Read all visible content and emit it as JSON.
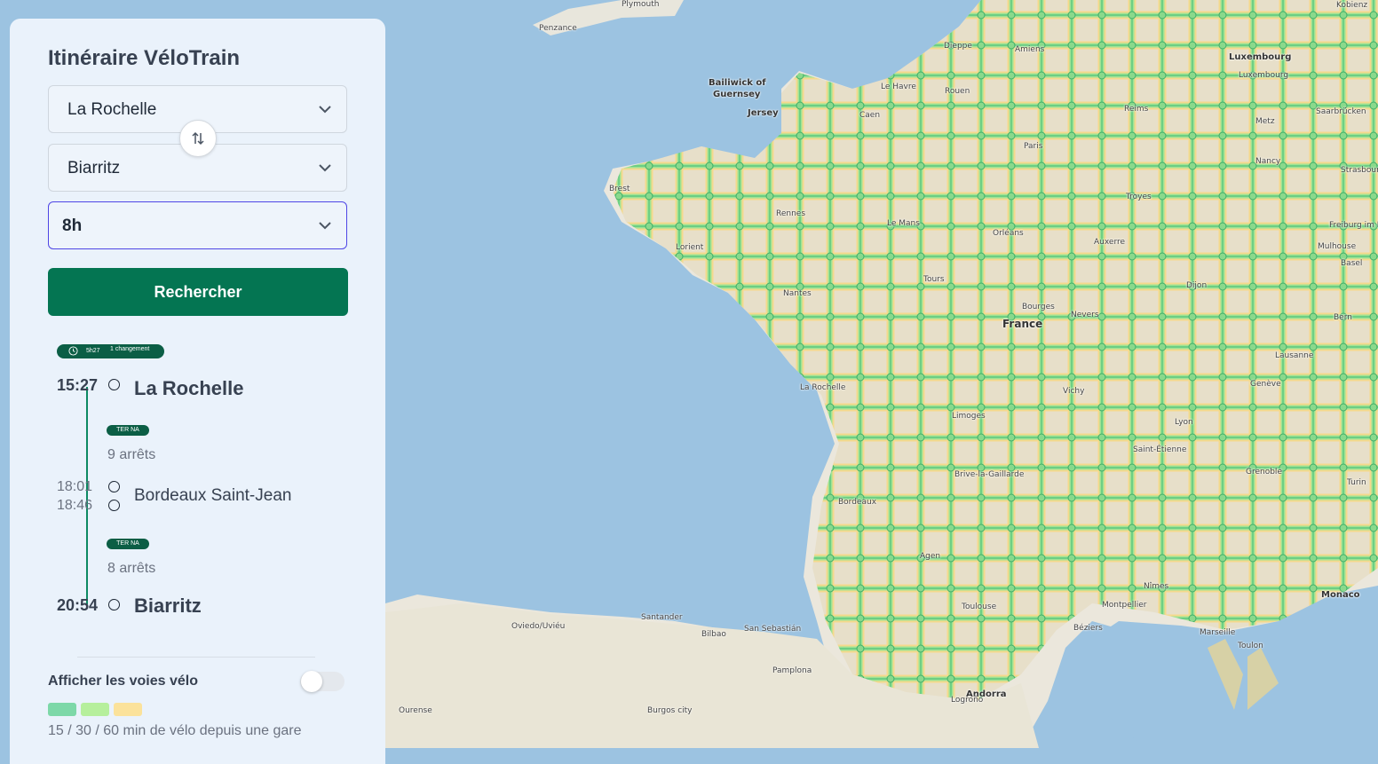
{
  "panel": {
    "title": "Itinéraire VéloTrain",
    "from_value": "La Rochelle",
    "to_value": "Biarritz",
    "time_value": "8h",
    "search_label": "Rechercher"
  },
  "result": {
    "duration": "5h27",
    "changes": "1 changement",
    "origin": {
      "time": "15:27",
      "station": "La Rochelle"
    },
    "leg1": {
      "line": "TER NA",
      "stops": "9 arrêts"
    },
    "transfer": {
      "arrival": "18:01",
      "departure": "18:46",
      "station": "Bordeaux Saint-Jean"
    },
    "leg2": {
      "line": "TER NA",
      "stops": "8 arrêts"
    },
    "destination": {
      "time": "20:54",
      "station": "Biarritz"
    }
  },
  "bike_layer": {
    "toggle_label": "Afficher les voies vélo",
    "enabled": false,
    "legend_colors": [
      "#7dd8a8",
      "#b6ef9c",
      "#fbe29b"
    ],
    "legend_text": "15 / 30 / 60 min de vélo depuis une gare"
  },
  "map": {
    "labels": [
      {
        "text": "Plymouth",
        "cls": ""
      },
      {
        "text": "Penzance",
        "cls": ""
      },
      {
        "text": "Kobienz",
        "cls": ""
      },
      {
        "text": "Dieppe",
        "cls": ""
      },
      {
        "text": "Amiens",
        "cls": ""
      },
      {
        "text": "Luxembourg",
        "cls": "mid"
      },
      {
        "text": "Luxembourg",
        "cls": ""
      },
      {
        "text": "Bailiwick of",
        "cls": "mid"
      },
      {
        "text": "Guernsey",
        "cls": "mid"
      },
      {
        "text": "Jersey",
        "cls": "mid"
      },
      {
        "text": "Le Havre",
        "cls": ""
      },
      {
        "text": "Rouen",
        "cls": ""
      },
      {
        "text": "Reims",
        "cls": ""
      },
      {
        "text": "Metz",
        "cls": ""
      },
      {
        "text": "Saarbrücken",
        "cls": ""
      },
      {
        "text": "Caen",
        "cls": ""
      },
      {
        "text": "Paris",
        "cls": ""
      },
      {
        "text": "Nancy",
        "cls": ""
      },
      {
        "text": "Strasbourg",
        "cls": ""
      },
      {
        "text": "Brest",
        "cls": ""
      },
      {
        "text": "Rennes",
        "cls": ""
      },
      {
        "text": "Troyes",
        "cls": ""
      },
      {
        "text": "Le Mans",
        "cls": ""
      },
      {
        "text": "Orléans",
        "cls": ""
      },
      {
        "text": "Auxerre",
        "cls": ""
      },
      {
        "text": "Freiburg im B",
        "cls": ""
      },
      {
        "text": "Lorient",
        "cls": ""
      },
      {
        "text": "Mulhouse",
        "cls": ""
      },
      {
        "text": "Basel",
        "cls": ""
      },
      {
        "text": "Tours",
        "cls": ""
      },
      {
        "text": "Dijon",
        "cls": ""
      },
      {
        "text": "Nantes",
        "cls": ""
      },
      {
        "text": "Bourges",
        "cls": ""
      },
      {
        "text": "Nevers",
        "cls": ""
      },
      {
        "text": "Bern",
        "cls": ""
      },
      {
        "text": "France",
        "cls": "big"
      },
      {
        "text": "Lausanne",
        "cls": ""
      },
      {
        "text": "La Rochelle",
        "cls": ""
      },
      {
        "text": "Genève",
        "cls": ""
      },
      {
        "text": "Vichy",
        "cls": ""
      },
      {
        "text": "Limoges",
        "cls": ""
      },
      {
        "text": "Lyon",
        "cls": ""
      },
      {
        "text": "Saint-Étienne",
        "cls": ""
      },
      {
        "text": "Brive-la-Gaillarde",
        "cls": ""
      },
      {
        "text": "Grenoble",
        "cls": ""
      },
      {
        "text": "Bordeaux",
        "cls": ""
      },
      {
        "text": "Turin",
        "cls": ""
      },
      {
        "text": "Agen",
        "cls": ""
      },
      {
        "text": "Nîmes",
        "cls": ""
      },
      {
        "text": "Monaco",
        "cls": "mid"
      },
      {
        "text": "Montpellier",
        "cls": ""
      },
      {
        "text": "Toulouse",
        "cls": ""
      },
      {
        "text": "Santander",
        "cls": ""
      },
      {
        "text": "Oviedo/Uviéu",
        "cls": ""
      },
      {
        "text": "Bilbao",
        "cls": ""
      },
      {
        "text": "San Sebastián",
        "cls": ""
      },
      {
        "text": "Béziers",
        "cls": ""
      },
      {
        "text": "Marseille",
        "cls": ""
      },
      {
        "text": "Toulon",
        "cls": ""
      },
      {
        "text": "Pamplona",
        "cls": ""
      },
      {
        "text": "Andorra",
        "cls": "mid"
      },
      {
        "text": "Logroño",
        "cls": ""
      },
      {
        "text": "Ourense",
        "cls": ""
      },
      {
        "text": "Burgos city",
        "cls": ""
      }
    ]
  }
}
